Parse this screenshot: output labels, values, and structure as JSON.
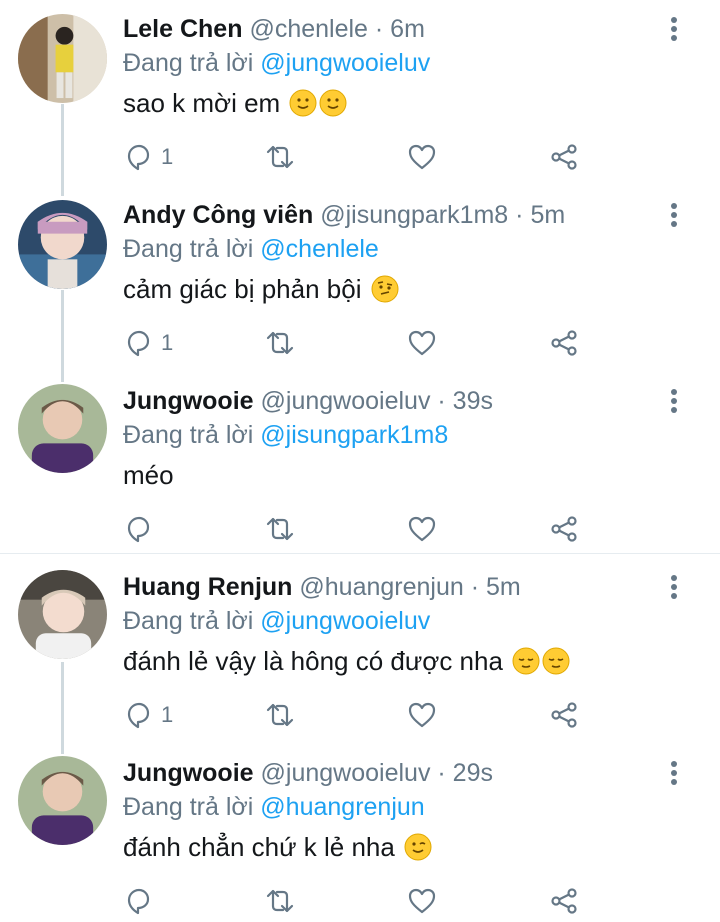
{
  "reply_prefix": "Đang trả lời",
  "colors": {
    "accent": "#1da1f2",
    "muted": "#657786",
    "text": "#14171a"
  },
  "icons": {
    "reply": "reply-icon",
    "retweet": "retweet-icon",
    "like": "heart-icon",
    "share": "share-icon",
    "more": "more-vertical-icon"
  },
  "tweets": [
    {
      "name": "Lele Chen",
      "handle": "@chenlele",
      "time": "· 6m",
      "mention": "@jungwooieluv",
      "text": "sao k mời em",
      "emojis": [
        "slightly-smiling-face",
        "slightly-smiling-face"
      ],
      "reply_count": "1"
    },
    {
      "name": "Andy Công viên",
      "handle": "@jisungpark1m8",
      "time": "· 5m",
      "mention": "@chenlele",
      "text": "cảm giác bị phản bội",
      "emojis": [
        "raised-eyebrow-face"
      ],
      "reply_count": "1"
    },
    {
      "name": "Jungwooie",
      "handle": "@jungwooieluv",
      "time": "· 39s",
      "mention": "@jisungpark1m8",
      "text": "méo",
      "emojis": [],
      "reply_count": ""
    },
    {
      "name": "Huang Renjun",
      "handle": "@huangrenjun",
      "time": "· 5m",
      "mention": "@jungwooieluv",
      "text": "đánh lẻ vậy là hông có được nha",
      "emojis": [
        "relieved-face",
        "relieved-face"
      ],
      "reply_count": "1"
    },
    {
      "name": "Jungwooie",
      "handle": "@jungwooieluv",
      "time": "· 29s",
      "mention": "@huangrenjun",
      "text": "đánh chẳn chứ k lẻ nha",
      "emojis": [
        "winking-face"
      ],
      "reply_count": ""
    }
  ]
}
